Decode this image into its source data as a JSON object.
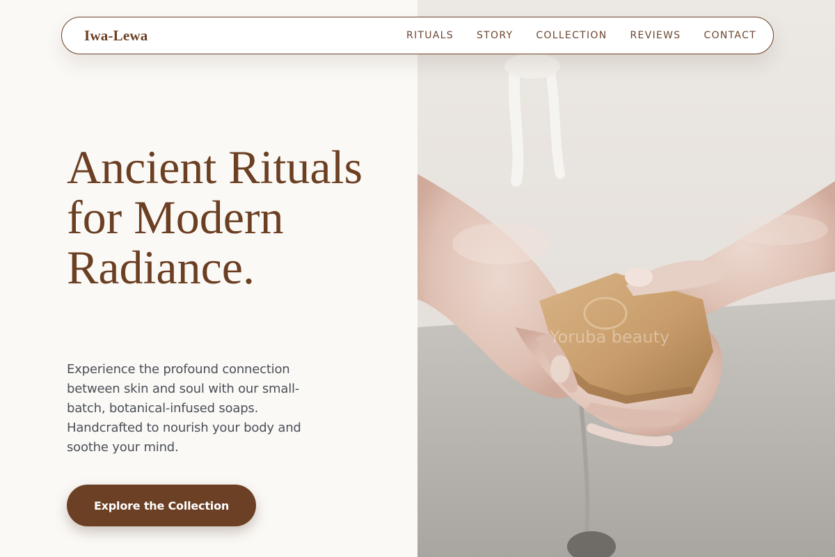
{
  "nav": {
    "logo": "Iwa-Lewa",
    "links": [
      {
        "label": "RITUALS"
      },
      {
        "label": "STORY"
      },
      {
        "label": "COLLECTION"
      },
      {
        "label": "REVIEWS"
      },
      {
        "label": "CONTACT"
      }
    ]
  },
  "hero": {
    "title": "Ancient Rituals for Modern Radiance.",
    "description": "Experience the profound connection between skin and soul with our small-batch, botanical-infused soaps. Handcrafted to nourish your body and soothe your mind.",
    "cta_label": "Explore the Collection",
    "image_watermark": "Yoruba beauty"
  },
  "colors": {
    "brand_brown": "#6b3f22",
    "button_brown": "#6b4024",
    "background": "#fbf9f6",
    "body_text": "#4a4f57"
  }
}
